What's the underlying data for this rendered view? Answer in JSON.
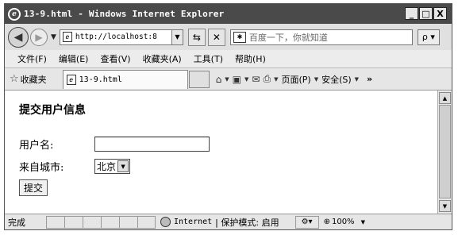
{
  "window": {
    "title": "13-9.html - Windows Internet Explorer",
    "logo_glyph": "e",
    "minimize": "_",
    "maximize": "□",
    "close": "X"
  },
  "address_bar": {
    "url": "http://localhost:8",
    "page_icon": "e",
    "search_placeholder": "百度一下，你就知道",
    "search_engine_icon": "paw-icon",
    "search_go": "ρ ▾"
  },
  "menu": {
    "items": [
      "文件(F)",
      "编辑(E)",
      "查看(V)",
      "收藏夹(A)",
      "工具(T)",
      "帮助(H)"
    ]
  },
  "favorites_bar": {
    "favorites_label": "收藏夹",
    "tab_label": "13-9.html",
    "page_menu": "页面(P)",
    "safety_menu": "安全(S)",
    "more": "»"
  },
  "page": {
    "heading": "提交用户信息",
    "username_label": "用户名:",
    "username_value": "",
    "city_label": "来自城市:",
    "city_selected": "北京",
    "submit_label": "提交"
  },
  "status_bar": {
    "status_text": "完成",
    "zone": "Internet",
    "protected_mode": "| 保护模式: 启用",
    "zoom": "100%"
  }
}
